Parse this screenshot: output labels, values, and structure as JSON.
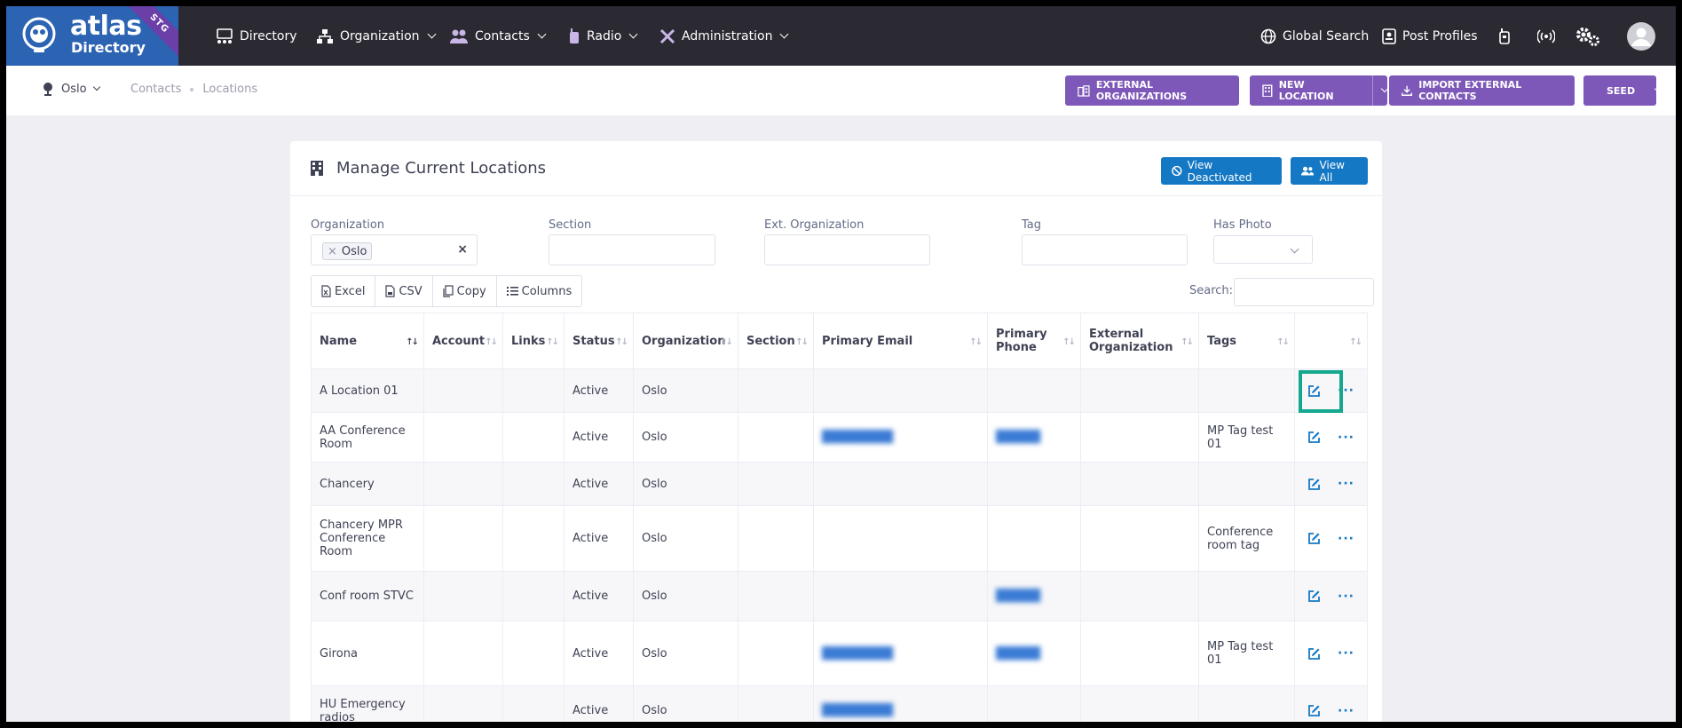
{
  "brand": {
    "name": "atlas",
    "sub": "Directory",
    "env": "STG"
  },
  "nav": {
    "directory": "Directory",
    "organization": "Organization",
    "contacts": "Contacts",
    "radio": "Radio",
    "administration": "Administration",
    "global_search": "Global Search",
    "post_profiles": "Post Profiles"
  },
  "subbar": {
    "org": "Oslo",
    "crumbs": [
      "Contacts",
      "Locations"
    ],
    "btn_external_orgs": "EXTERNAL ORGANIZATIONS",
    "btn_new_location": "NEW LOCATION",
    "btn_import": "IMPORT EXTERNAL CONTACTS",
    "btn_seed": "SEED"
  },
  "card": {
    "title": "Manage Current Locations",
    "btn_view_deactivated": "View Deactivated",
    "btn_view_all": "View All"
  },
  "filters": {
    "organization_label": "Organization",
    "organization_value": "Oslo",
    "section_label": "Section",
    "ext_org_label": "Ext. Organization",
    "tag_label": "Tag",
    "has_photo_label": "Has Photo"
  },
  "toolbar": {
    "excel": "Excel",
    "csv": "CSV",
    "copy": "Copy",
    "columns": "Columns",
    "search_label": "Search:"
  },
  "table": {
    "headers": {
      "name": "Name",
      "account": "Account",
      "links": "Links",
      "status": "Status",
      "organization": "Organization",
      "section": "Section",
      "primary_email": "Primary Email",
      "primary_phone": "Primary Phone",
      "external_org": "External Organization",
      "tags": "Tags"
    },
    "rows": [
      {
        "name": "A Location 01",
        "status": "Active",
        "organization": "Oslo",
        "email": "",
        "phone": "",
        "tags": ""
      },
      {
        "name": "AA Conference Room",
        "status": "Active",
        "organization": "Oslo",
        "email": "",
        "phone": "",
        "tags": "MP Tag test 01"
      },
      {
        "name": "Chancery",
        "status": "Active",
        "organization": "Oslo",
        "email": "",
        "phone": "",
        "tags": ""
      },
      {
        "name": "Chancery MPR Conference Room",
        "status": "Active",
        "organization": "Oslo",
        "email": "",
        "phone": "",
        "tags": "Conference room tag"
      },
      {
        "name": "Conf room STVC",
        "status": "Active",
        "organization": "Oslo",
        "email": "",
        "phone": "",
        "tags": ""
      },
      {
        "name": "Girona",
        "status": "Active",
        "organization": "Oslo",
        "email": "",
        "phone": "",
        "tags": "MP Tag test 01"
      },
      {
        "name": "HU Emergency radios",
        "status": "Active",
        "organization": "Oslo",
        "email": "",
        "phone": "",
        "tags": ""
      }
    ]
  },
  "colors": {
    "topbar": "#2b2a33",
    "brand_blue": "#2c63b3",
    "purple_button": "#7e58b8",
    "blue_button": "#1478c4",
    "highlight": "#14a88e"
  }
}
